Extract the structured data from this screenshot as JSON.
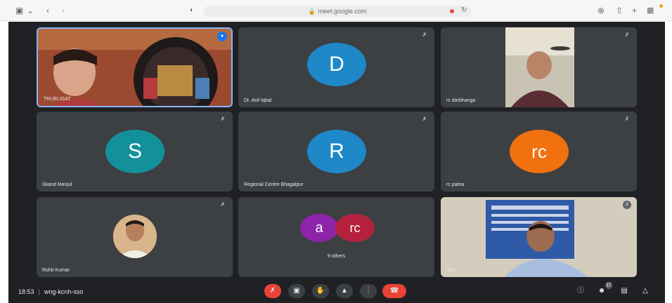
{
  "browser": {
    "url": "meet.google.com",
    "icons": [
      "sidebar-icon",
      "chevron-down-icon",
      "back-icon",
      "forward-icon",
      "shield-icon",
      "camera-icon",
      "refresh-icon",
      "download-icon",
      "share-icon",
      "new-tab-icon",
      "tabs-icon"
    ]
  },
  "participants": [
    {
      "name": "TRUELIGAT",
      "type": "video",
      "speaking": true
    },
    {
      "name": "Dr. Asif Iqbal",
      "type": "avatar",
      "initials": "D",
      "color": "#1e88c8",
      "muted": true
    },
    {
      "name": "rc darbhanga",
      "type": "video",
      "muted": true
    },
    {
      "name": "Skand Manjul",
      "type": "avatar",
      "initials": "S",
      "color": "#13919b",
      "muted": true
    },
    {
      "name": "Regional Centre Bhagalpur",
      "type": "avatar",
      "initials": "R",
      "color": "#1e88c8",
      "muted": true
    },
    {
      "name": "rc patna",
      "type": "avatar",
      "initials": "rc",
      "color": "#f1710f",
      "muted": true
    },
    {
      "name": "Rohit Kumar",
      "type": "video-avatar",
      "muted": true
    },
    {
      "name": "9 others",
      "type": "group",
      "avatars": [
        {
          "initials": "a",
          "color": "#8e24aa"
        },
        {
          "initials": "rc",
          "color": "#b5213d"
        }
      ]
    },
    {
      "name": "You",
      "type": "video",
      "muted": true
    }
  ],
  "footer": {
    "time": "18:53",
    "meeting_code": "wng-kcnh-sso",
    "people_count": "17",
    "colors": {
      "hangup": "#ea4335",
      "button": "#3c4043"
    }
  }
}
